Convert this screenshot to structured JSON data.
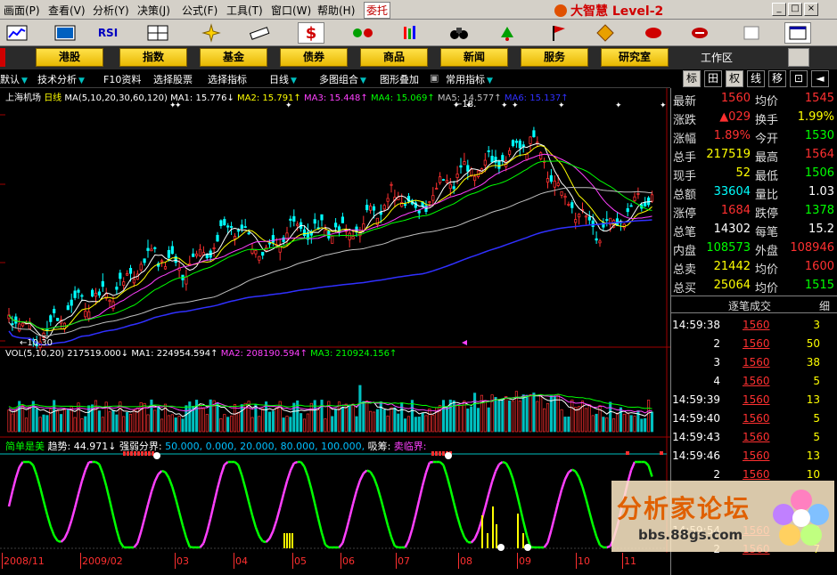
{
  "menu": {
    "items": [
      "画面(P)",
      "查看(V)",
      "分析(Y)",
      "决策(J)",
      "公式(F)",
      "工具(T)",
      "窗口(W)",
      "帮助(H)",
      "委托"
    ],
    "logo": "大智慧 Level-2"
  },
  "toolbar": {
    "rsi_label": "RSI"
  },
  "nav": {
    "items": [
      "港股",
      "指数",
      "基金",
      "债券",
      "商品",
      "新闻",
      "服务",
      "研究室"
    ],
    "workzone": "工作区"
  },
  "chartbar": {
    "items": [
      "默认",
      "技术分析",
      "F10资料",
      "选择股票",
      "选择指标",
      "日线",
      "多图组合",
      "图形叠加",
      "常用指标"
    ]
  },
  "tabs": {
    "items": [
      "标",
      "田",
      "权",
      "线",
      "移",
      "",
      ""
    ]
  },
  "chart": {
    "title": "上海机场",
    "period": "日线",
    "ma_params": "MA(5,10,20,30,60,120)",
    "ma": [
      {
        "name": "MA1:",
        "value": "15.776",
        "arrow": "↓",
        "color": "#ffffff"
      },
      {
        "name": "MA2:",
        "value": "15.791",
        "arrow": "↑",
        "color": "#ffff00"
      },
      {
        "name": "MA3:",
        "value": "15.448",
        "arrow": "↑",
        "color": "#ff40ff"
      },
      {
        "name": "MA4:",
        "value": "15.069",
        "arrow": "↑",
        "color": "#00ff00"
      },
      {
        "name": "MA5:",
        "value": "14.577",
        "arrow": "↑",
        "color": "#c0c0c0"
      },
      {
        "name": "MA6:",
        "value": "15.137",
        "arrow": "↑",
        "color": "#3030ff"
      }
    ],
    "high_label": "18.",
    "low_label": "10.30",
    "vol": {
      "params": "VOL(5,10,20)",
      "value": "217519.000",
      "arrow": "↓",
      "ma": [
        {
          "name": "MA1:",
          "value": "224954.594",
          "arrow": "↑",
          "color": "#ffffff"
        },
        {
          "name": "MA2:",
          "value": "208190.594",
          "arrow": "↑",
          "color": "#ff40ff"
        },
        {
          "name": "MA3:",
          "value": "210924.156",
          "arrow": "↑",
          "color": "#00ff00"
        }
      ]
    },
    "ind": {
      "name": "简单是美",
      "trend_label": "趋势:",
      "trend": "44.971",
      "arrow": "↓",
      "line_label": "强弱分界:",
      "levels": "50.000, 0.000, 20.000, 80.000, 100.000,",
      "absorb": "吸筹:",
      "sell": "卖临界:"
    },
    "dates": [
      "2008/11",
      "2009/02",
      "03",
      "04",
      "05",
      "06",
      "07",
      "08",
      "09",
      "10",
      "11"
    ]
  },
  "quote": {
    "rows": [
      {
        "l1": "最新",
        "v1": "1560",
        "c1": "#ff3030",
        "l2": "均价",
        "v2": "1545",
        "c2": "#ff3030"
      },
      {
        "l1": "涨跌",
        "v1": "▲029",
        "c1": "#ff3030",
        "l2": "换手",
        "v2": "1.99%",
        "c2": "#ffff00"
      },
      {
        "l1": "涨幅",
        "v1": "1.89%",
        "c1": "#ff3030",
        "l2": "今开",
        "v2": "1530",
        "c2": "#00ff00"
      },
      {
        "l1": "总手",
        "v1": "217519",
        "c1": "#ffff00",
        "l2": "最高",
        "v2": "1564",
        "c2": "#ff3030"
      },
      {
        "l1": "现手",
        "v1": "52",
        "c1": "#ffff00",
        "l2": "最低",
        "v2": "1506",
        "c2": "#00ff00"
      },
      {
        "l1": "总额",
        "v1": "33604",
        "c1": "#00ffff",
        "l2": "量比",
        "v2": "1.03",
        "c2": "#ffffff"
      },
      {
        "l1": "涨停",
        "v1": "1684",
        "c1": "#ff3030",
        "l2": "跌停",
        "v2": "1378",
        "c2": "#00ff00"
      },
      {
        "l1": "总笔",
        "v1": "14302",
        "c1": "#ffffff",
        "l2": "每笔",
        "v2": "15.2",
        "c2": "#ffffff"
      },
      {
        "l1": "内盘",
        "v1": "108573",
        "c1": "#00ff00",
        "l2": "外盘",
        "v2": "108946",
        "c2": "#ff3030"
      },
      {
        "l1": "总卖",
        "v1": "21442",
        "c1": "#ffff00",
        "l2": "均价",
        "v2": "1600",
        "c2": "#ff3030"
      },
      {
        "l1": "总买",
        "v1": "25064",
        "c1": "#ffff00",
        "l2": "均价",
        "v2": "1515",
        "c2": "#00ff00"
      }
    ],
    "ticks_header": "逐笔成交",
    "ticks_right": "细",
    "ticks": [
      {
        "time": "14:59:38",
        "price": "1560",
        "vol": "3"
      },
      {
        "time": "2",
        "price": "1560",
        "vol": "50"
      },
      {
        "time": "3",
        "price": "1560",
        "vol": "38"
      },
      {
        "time": "4",
        "price": "1560",
        "vol": "5"
      },
      {
        "time": "14:59:39",
        "price": "1560",
        "vol": "13"
      },
      {
        "time": "14:59:40",
        "price": "1560",
        "vol": "5"
      },
      {
        "time": "14:59:43",
        "price": "1560",
        "vol": "5"
      },
      {
        "time": "14:59:46",
        "price": "1560",
        "vol": "13"
      },
      {
        "time": "2",
        "price": "1560",
        "vol": "10"
      },
      {
        "time": "",
        "price": "",
        "vol": ""
      },
      {
        "time": "",
        "price": "",
        "vol": ""
      },
      {
        "time": "14:59:54",
        "price": "1560",
        "vol": "3"
      },
      {
        "time": "2",
        "price": "1560",
        "vol": "7"
      }
    ]
  },
  "watermark": {
    "title": "分析家论坛",
    "url": "bbs.88gs.com"
  }
}
